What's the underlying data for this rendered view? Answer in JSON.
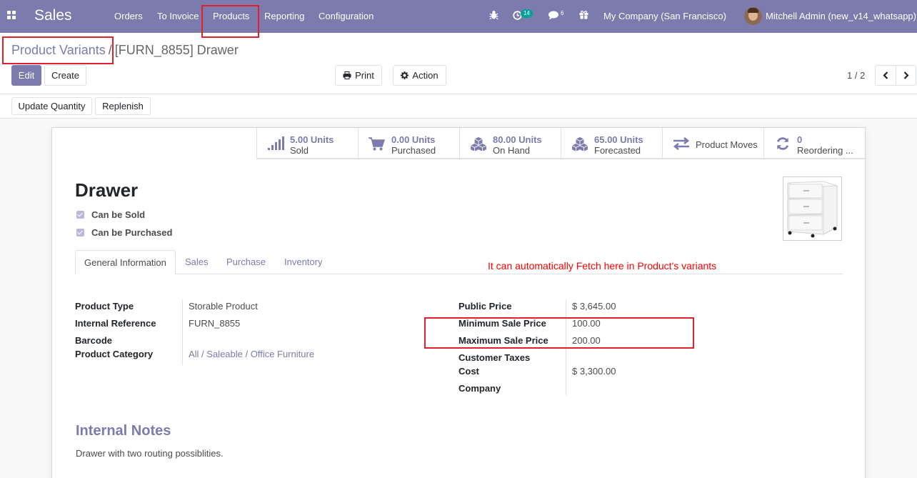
{
  "navbar": {
    "app_name": "Sales",
    "menu": [
      "Orders",
      "To Invoice",
      "Products",
      "Reporting",
      "Configuration"
    ],
    "activity_count": "14",
    "message_count": "6",
    "company": "My Company (San Francisco)",
    "user": "Mitchell Admin (new_v14_whatsapp)",
    "accent": "#7c7bad"
  },
  "breadcrumb": {
    "parent": "Product Variants",
    "separator": "/",
    "current": "[FURN_8855] Drawer"
  },
  "toolbar": {
    "edit": "Edit",
    "create": "Create",
    "print": "Print",
    "action": "Action",
    "pager": "1 / 2"
  },
  "statusbar": {
    "update_qty": "Update Quantity",
    "replenish": "Replenish"
  },
  "smart_buttons": [
    {
      "value": "5.00 Units",
      "label": "Sold",
      "icon": "bar-chart-icon"
    },
    {
      "value": "0.00 Units",
      "label": "Purchased",
      "icon": "cart-icon"
    },
    {
      "value": "80.00 Units",
      "label": "On Hand",
      "icon": "cubes-icon"
    },
    {
      "value": "65.00 Units",
      "label": "Forecasted",
      "icon": "cubes-icon"
    },
    {
      "value": "",
      "label": "Product Moves",
      "icon": "exchange-icon"
    },
    {
      "value": "0",
      "label": "Reordering ...",
      "icon": "refresh-icon"
    }
  ],
  "product": {
    "name": "Drawer",
    "can_be_sold": "Can be Sold",
    "can_be_purchased": "Can be Purchased"
  },
  "tabs": [
    "General Information",
    "Sales",
    "Purchase",
    "Inventory"
  ],
  "annotation": "It can automatically Fetch here in Product's variants",
  "left_fields": [
    {
      "label": "Product Type",
      "value": "Storable Product"
    },
    {
      "label": "Internal Reference",
      "value": "FURN_8855"
    },
    {
      "label": "Barcode",
      "value": ""
    },
    {
      "label": "Product Category",
      "value": "All / Saleable / Office Furniture"
    }
  ],
  "right_fields": [
    {
      "label": "Public Price",
      "value": "$ 3,645.00"
    },
    {
      "label": "Minimum Sale Price",
      "value": "100.00"
    },
    {
      "label": "Maximum Sale Price",
      "value": "200.00"
    },
    {
      "label": "Customer Taxes",
      "value": ""
    },
    {
      "label": "Cost",
      "value": "$ 3,300.00"
    },
    {
      "label": "Company",
      "value": ""
    }
  ],
  "internal_notes": {
    "heading": "Internal Notes",
    "text": "Drawer with two routing possiblities."
  }
}
